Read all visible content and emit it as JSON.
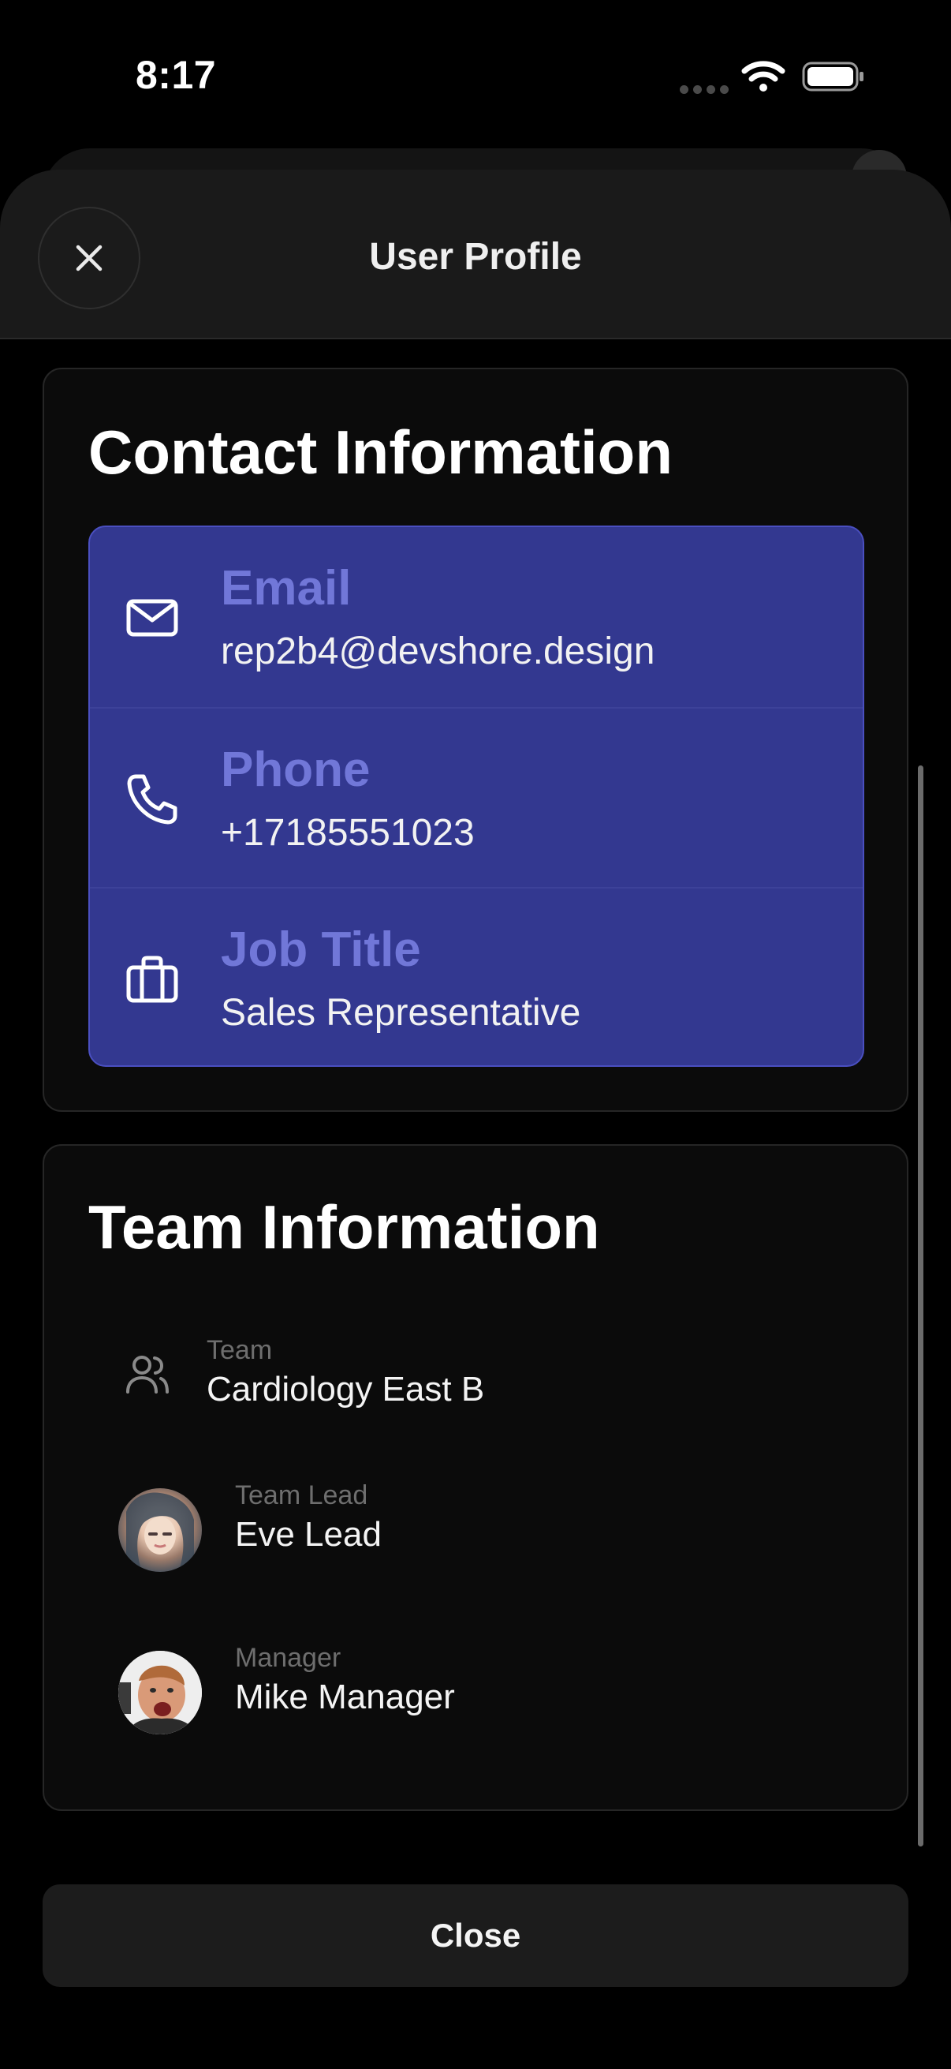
{
  "status_bar": {
    "time": "8:17"
  },
  "header": {
    "title": "User Profile"
  },
  "contact": {
    "title": "Contact Information",
    "rows": [
      {
        "label": "Email",
        "value": "rep2b4@devshore.design",
        "icon": "mail-icon"
      },
      {
        "label": "Phone",
        "value": "+17185551023",
        "icon": "phone-icon"
      },
      {
        "label": "Job Title",
        "value": "Sales Representative",
        "icon": "briefcase-icon"
      }
    ]
  },
  "team": {
    "title": "Team Information",
    "items": [
      {
        "label": "Team",
        "value": "Cardiology East B",
        "icon": "users-icon"
      },
      {
        "label": "Team Lead",
        "value": "Eve Lead",
        "icon": "avatar"
      },
      {
        "label": "Manager",
        "value": "Mike Manager",
        "icon": "avatar"
      }
    ]
  },
  "footer": {
    "close_label": "Close"
  },
  "colors": {
    "panel": "#333890",
    "panel_label": "#7177d8",
    "background": "#000000"
  }
}
